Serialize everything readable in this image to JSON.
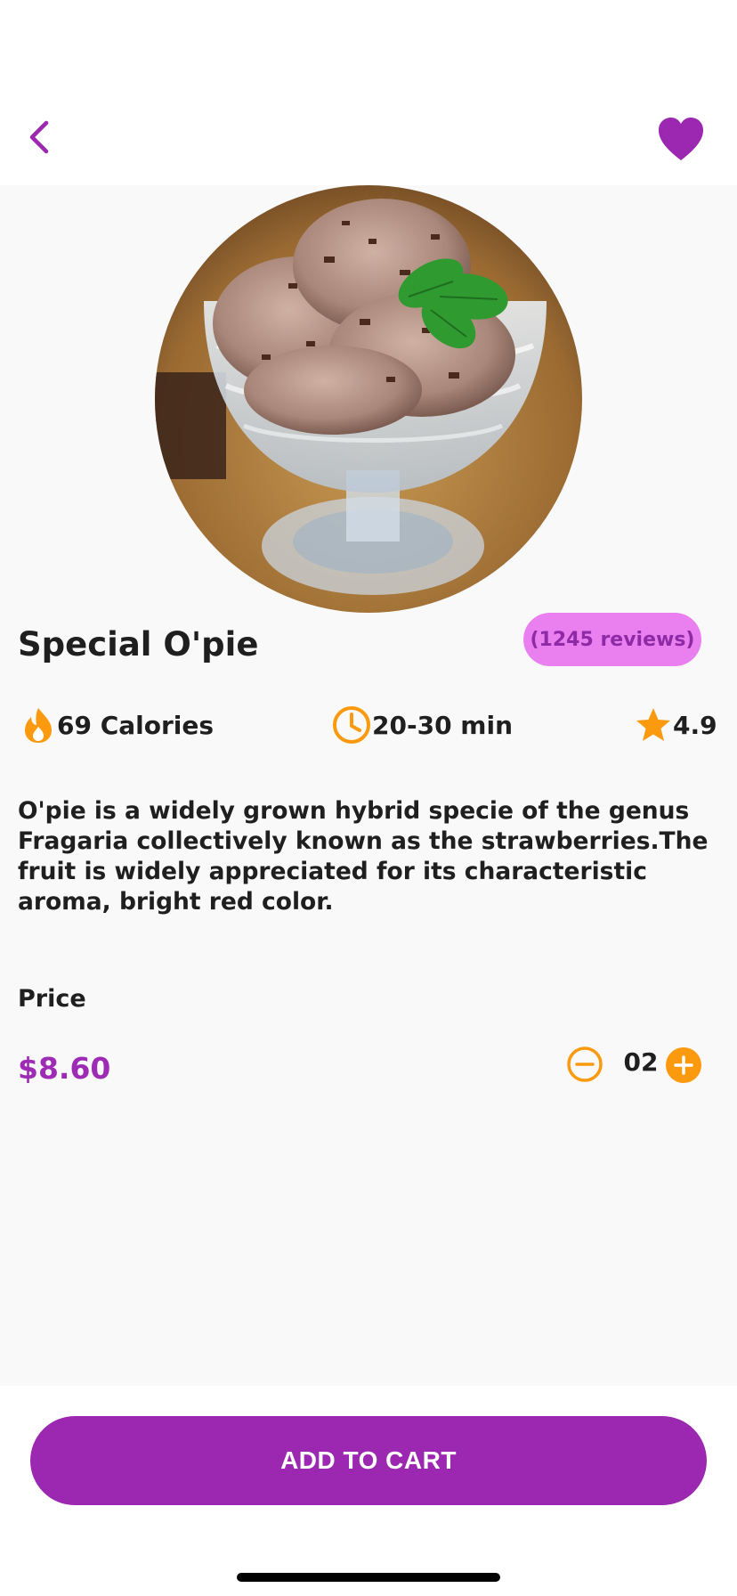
{
  "colors": {
    "accent": "#9c27b0",
    "price": "#9d2bb3",
    "reviews_badge_bg": "#ea80f0",
    "reviews_badge_text": "#8e2aa6",
    "icon_orange": "#fb9a0f"
  },
  "header": {
    "back_icon": "chevron-left-icon",
    "favorite_icon": "heart-icon",
    "favorited": true
  },
  "product": {
    "image_desc": "chocolate-ice-cream-in-glass-cup",
    "name": "Special O'pie",
    "reviews": "(1245 reviews)",
    "calories": "69 Calories",
    "time": "20-30 min",
    "rating": "4.9",
    "description": "O'pie is a widely grown hybrid specie of the genus Fragaria collectively known as the strawberries.The fruit is widely appreciated for its characteristic aroma, bright red color."
  },
  "price": {
    "label": "Price",
    "value": "$8.60"
  },
  "quantity": {
    "value": "02",
    "minus_icon": "minus-circle-icon",
    "plus_icon": "plus-circle-icon"
  },
  "cart": {
    "button_label": "ADD TO CART"
  }
}
